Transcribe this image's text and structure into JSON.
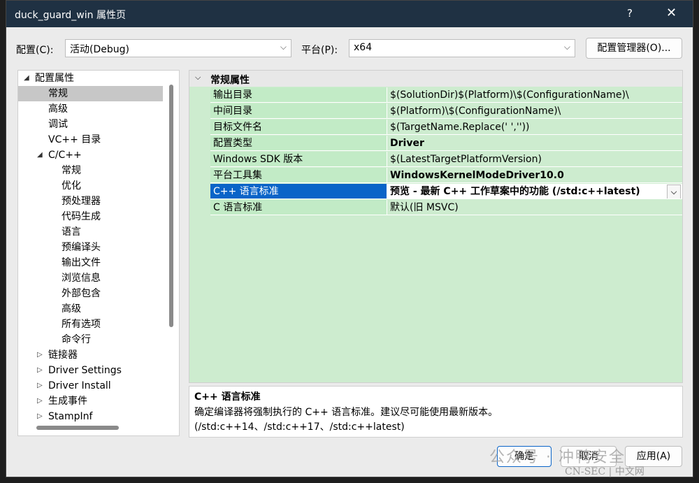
{
  "window": {
    "title": "duck_guard_win 属性页",
    "help": "?",
    "close": "✕"
  },
  "toolbar": {
    "config_label": "配置(C):",
    "config_value": "活动(Debug)",
    "platform_label": "平台(P):",
    "platform_value": "x64",
    "config_manager_button": "配置管理器(O)..."
  },
  "tree": {
    "items": [
      {
        "label": "配置属性",
        "level": 0,
        "expander": "◢"
      },
      {
        "label": "常规",
        "level": 1,
        "selected": true
      },
      {
        "label": "高级",
        "level": 1
      },
      {
        "label": "调试",
        "level": 1
      },
      {
        "label": "VC++ 目录",
        "level": 1
      },
      {
        "label": "C/C++",
        "level": 1,
        "expander": "◢"
      },
      {
        "label": "常规",
        "level": 2
      },
      {
        "label": "优化",
        "level": 2
      },
      {
        "label": "预处理器",
        "level": 2
      },
      {
        "label": "代码生成",
        "level": 2
      },
      {
        "label": "语言",
        "level": 2
      },
      {
        "label": "预编译头",
        "level": 2
      },
      {
        "label": "输出文件",
        "level": 2
      },
      {
        "label": "浏览信息",
        "level": 2
      },
      {
        "label": "外部包含",
        "level": 2
      },
      {
        "label": "高级",
        "level": 2
      },
      {
        "label": "所有选项",
        "level": 2
      },
      {
        "label": "命令行",
        "level": 2
      },
      {
        "label": "链接器",
        "level": 1,
        "expander": "▷"
      },
      {
        "label": "Driver Settings",
        "level": 1,
        "expander": "▷"
      },
      {
        "label": "Driver Install",
        "level": 1,
        "expander": "▷"
      },
      {
        "label": "生成事件",
        "level": 1,
        "expander": "▷"
      },
      {
        "label": "StampInf",
        "level": 1,
        "expander": "▷"
      }
    ]
  },
  "grid": {
    "section": "常规属性",
    "rows": [
      {
        "name": "输出目录",
        "value": "$(SolutionDir)$(Platform)\\$(ConfigurationName)\\"
      },
      {
        "name": "中间目录",
        "value": "$(Platform)\\$(ConfigurationName)\\"
      },
      {
        "name": "目标文件名",
        "value": "$(TargetName.Replace(' ',''))"
      },
      {
        "name": "配置类型",
        "value": "Driver",
        "bold": true
      },
      {
        "name": "Windows SDK 版本",
        "value": "$(LatestTargetPlatformVersion)"
      },
      {
        "name": "平台工具集",
        "value": "WindowsKernelModeDriver10.0",
        "bold": true
      },
      {
        "name": "C++ 语言标准",
        "value": "预览 - 最新 C++ 工作草案中的功能 (/std:c++latest)",
        "bold": true,
        "selected": true
      },
      {
        "name": "C 语言标准",
        "value": "默认(旧 MSVC)"
      }
    ]
  },
  "description": {
    "title": "C++ 语言标准",
    "text": "确定编译器将强制执行的 C++ 语言标准。建议尽可能使用最新版本。(/std:c++14、/std:c++17、/std:c++latest)"
  },
  "buttons": {
    "ok": "确定",
    "cancel": "取消",
    "apply": "应用(A)"
  },
  "watermark": {
    "line1": "公众号 · 冲鸭安全",
    "line2": "CN-SEC | 中文网"
  }
}
